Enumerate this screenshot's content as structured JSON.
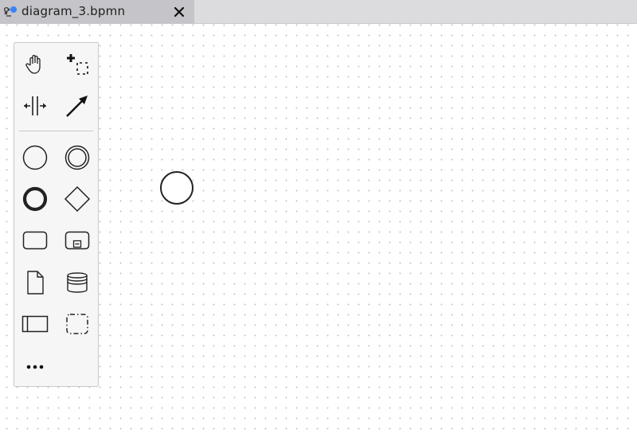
{
  "tab": {
    "title": "diagram_3.bpmn",
    "icon": "bpmn-modeler-icon",
    "close_icon": "close-icon",
    "unsaved_dot_color": "#3b82f6"
  },
  "palette": {
    "tools": [
      {
        "id": "hand-tool",
        "icon": "hand-icon"
      },
      {
        "id": "lasso-tool",
        "icon": "lasso-icon"
      },
      {
        "id": "space-tool",
        "icon": "space-icon"
      },
      {
        "id": "connect-tool",
        "icon": "arrow-icon"
      },
      {
        "id": "start-event",
        "icon": "start-event-icon"
      },
      {
        "id": "intermediate-event",
        "icon": "intermediate-event-icon"
      },
      {
        "id": "end-event",
        "icon": "end-event-icon"
      },
      {
        "id": "gateway",
        "icon": "gateway-icon"
      },
      {
        "id": "task",
        "icon": "task-icon"
      },
      {
        "id": "subprocess",
        "icon": "subprocess-icon"
      },
      {
        "id": "data-object",
        "icon": "data-object-icon"
      },
      {
        "id": "data-store",
        "icon": "data-store-icon"
      },
      {
        "id": "pool",
        "icon": "pool-icon"
      },
      {
        "id": "group",
        "icon": "group-icon"
      },
      {
        "id": "more-tools",
        "icon": "more-icon"
      }
    ]
  },
  "diagram": {
    "elements": [
      {
        "type": "start-event"
      }
    ]
  }
}
